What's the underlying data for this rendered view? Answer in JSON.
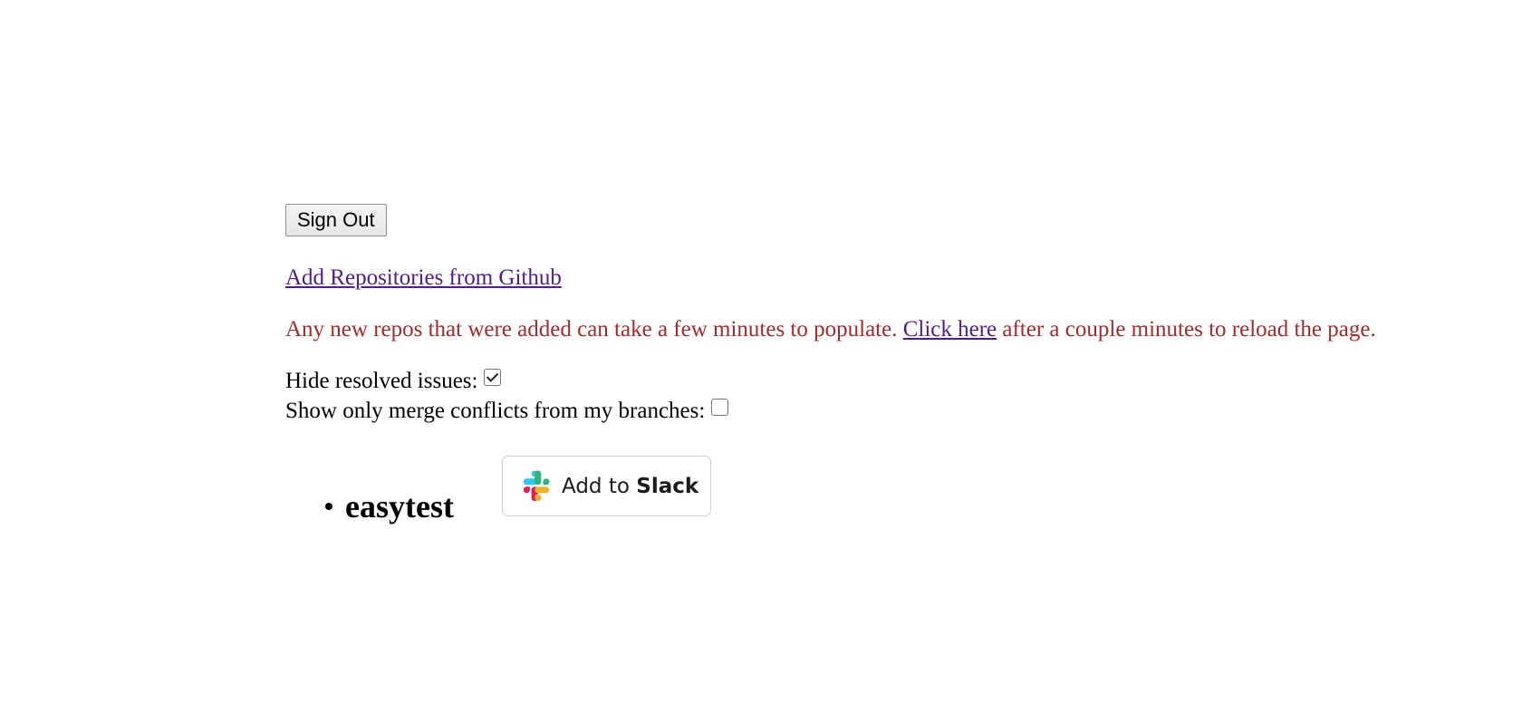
{
  "actions": {
    "sign_out_label": "Sign Out",
    "add_repos_label": "Add Repositories from Github"
  },
  "notice": {
    "text_before": "Any new repos that were added can take a few minutes to populate. ",
    "link_label": "Click here",
    "text_after": " after a couple minutes to reload the page."
  },
  "options": [
    {
      "label": "Hide resolved issues:",
      "checked": true
    },
    {
      "label": "Show only merge conflicts from my branches:",
      "checked": false
    }
  ],
  "repos": [
    {
      "name": "easytest"
    }
  ],
  "slack": {
    "prefix": "Add to ",
    "brand": "Slack",
    "icon": "slack-logo-icon",
    "colors": {
      "blue": "#36C5F0",
      "green": "#2EB67D",
      "yellow": "#ECB22E",
      "red": "#E01E5A"
    }
  },
  "colors": {
    "notice_text": "#a52a2a",
    "link": "#551a8b"
  }
}
